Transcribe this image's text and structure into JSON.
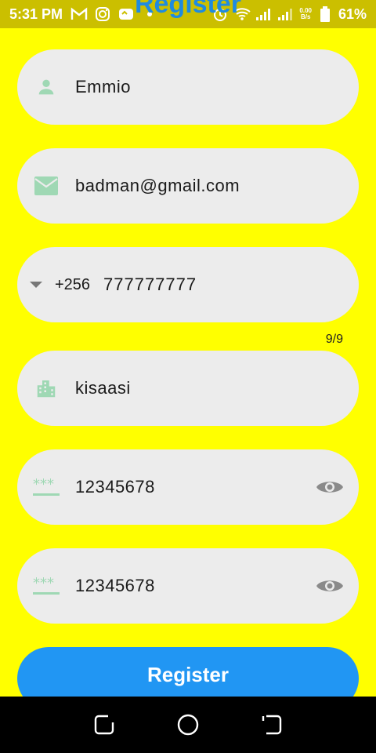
{
  "status_bar": {
    "time": "5:31 PM",
    "net_speed_value": "0.00",
    "net_speed_unit": "B/s",
    "battery": "61%"
  },
  "header": {
    "title": "Register"
  },
  "form": {
    "name": {
      "value": "Emmio",
      "icon": "person-icon"
    },
    "email": {
      "value": "badman@gmail.com",
      "icon": "email-icon"
    },
    "phone": {
      "country_code": "+256",
      "number": "777777777",
      "counter": "9/9"
    },
    "location": {
      "value": "kisaasi",
      "icon": "location-city-icon"
    },
    "password": {
      "value": "12345678",
      "icon": "password-icon",
      "toggle": "eye-icon"
    },
    "confirm_password": {
      "value": "12345678",
      "icon": "password-icon",
      "toggle": "eye-icon"
    }
  },
  "register_button": {
    "label": "Register"
  },
  "colors": {
    "background": "#ffff00",
    "field": "#ececec",
    "icon_green": "#9fd8b4",
    "button": "#2196f3",
    "title": "#1f8be0"
  }
}
